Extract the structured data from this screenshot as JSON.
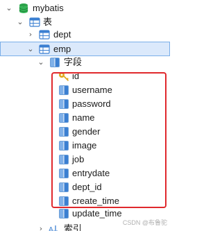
{
  "tree": {
    "database": "mybatis",
    "tables_group": "表",
    "tables": [
      "dept",
      "emp"
    ],
    "fields_group": "字段",
    "fields": [
      "id",
      "username",
      "password",
      "name",
      "gender",
      "image",
      "job",
      "entrydate",
      "dept_id",
      "create_time",
      "update_time"
    ],
    "partial_next_group": "索引"
  },
  "watermark": "CSDN @布鲁驼",
  "colors": {
    "selection_bg": "#dbe9fb",
    "selection_border": "#7aaee8",
    "highlight_border": "#e0282c",
    "db_icon": "#2ca34a",
    "key_icon": "#e0a81e"
  },
  "icons": {
    "database": "database-icon",
    "tables_group": "table-group-icon",
    "table": "table-icon",
    "column": "column-icon",
    "primary_key": "key-icon",
    "index": "index-icon"
  }
}
